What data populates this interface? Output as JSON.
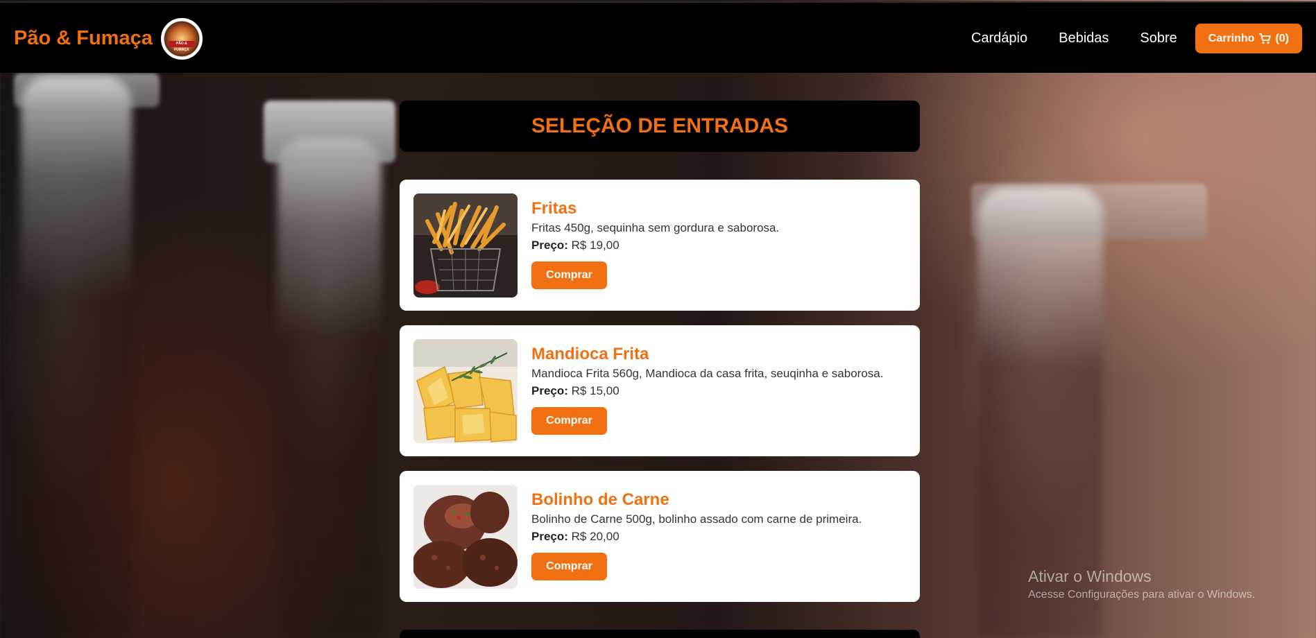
{
  "header": {
    "brand_name": "Pão & Fumaça",
    "logo_text": "PÃO & FUMAÇA",
    "nav": [
      {
        "label": "Cardápio"
      },
      {
        "label": "Bebidas"
      },
      {
        "label": "Sobre"
      }
    ],
    "cart": {
      "label": "Carrinho",
      "count": "(0)",
      "icon": "cart-icon"
    }
  },
  "main": {
    "section_title": "SELEÇÃO DE ENTRADAS",
    "items": [
      {
        "name": "Fritas",
        "description": "Fritas 450g, sequinha sem gordura e saborosa.",
        "price_label": "Preço:",
        "price": "R$ 19,00",
        "button": "Comprar",
        "image": "french-fries-basket-image"
      },
      {
        "name": "Mandioca Frita",
        "description": "Mandioca Frita 560g, Mandioca da casa frita, seuqinha e saborosa.",
        "price_label": "Preço:",
        "price": "R$ 15,00",
        "button": "Comprar",
        "image": "fried-cassava-image"
      },
      {
        "name": "Bolinho de Carne",
        "description": "Bolinho de Carne 500g, bolinho assado com carne de primeira.",
        "price_label": "Preço:",
        "price": "R$ 20,00",
        "button": "Comprar",
        "image": "meatballs-image"
      }
    ]
  },
  "windows_watermark": {
    "title": "Ativar o Windows",
    "subtitle": "Acesse Configurações para ativar o Windows."
  },
  "colors": {
    "accent": "#f07012",
    "navbar": "#000000",
    "card": "#ffffff"
  }
}
